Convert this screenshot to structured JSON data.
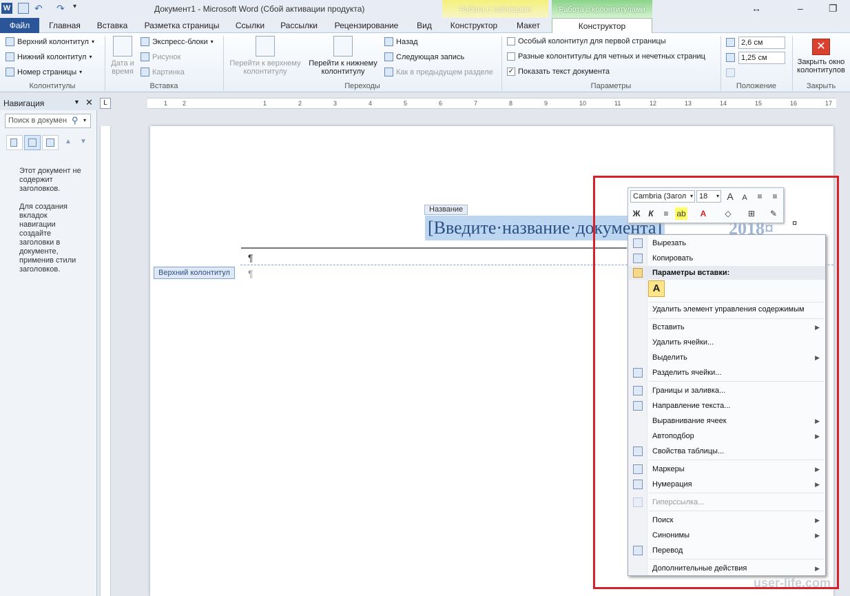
{
  "titlebar": {
    "app_icon": "W",
    "title": "Документ1  -  Microsoft Word (Сбой активации продукта)",
    "group_tables": "Работа с таблицами",
    "group_hf": "Работа с колонтитулами",
    "resize_icon": "↔",
    "minimize": "–",
    "restore": "❐"
  },
  "tabs": {
    "file": "Файл",
    "home": "Главная",
    "insert": "Вставка",
    "layout": "Разметка страницы",
    "refs": "Ссылки",
    "mail": "Рассылки",
    "review": "Рецензирование",
    "view": "Вид",
    "tbl_design": "Конструктор",
    "tbl_layout": "Макет",
    "hf_design": "Конструктор"
  },
  "ribbon": {
    "hf": {
      "header": "Верхний колонтитул",
      "footer": "Нижний колонтитул",
      "pagenum": "Номер страницы",
      "label": "Колонтитулы"
    },
    "insert": {
      "date": "Дата и время",
      "express": "Экспресс-блоки",
      "picture": "Рисунок",
      "clipart": "Картинка",
      "label": "Вставка"
    },
    "nav": {
      "go_header": "Перейти к верхнему колонтитулу",
      "go_footer": "Перейти к нижнему колонтитулу",
      "prev": "Назад",
      "next": "Следующая запись",
      "link_prev": "Как в предыдущем разделе",
      "label": "Переходы"
    },
    "opts": {
      "first": "Особый колонтитул для первой страницы",
      "oddeven": "Разные колонтитулы для четных и нечетных страниц",
      "showdoc": "Показать текст документа",
      "label": "Параметры"
    },
    "pos": {
      "top": "2,6 см",
      "bottom": "1,25 см",
      "label": "Положение"
    },
    "close": {
      "btn": "Закрыть окно колонтитулов",
      "label": "Закрыть"
    }
  },
  "nav": {
    "title": "Навигация",
    "search_placeholder": "Поиск в докумен",
    "text": "Этот документ не содержит заголовков.\n\nДля создания вкладок навигации создайте заголовки в документе, применив стили заголовков."
  },
  "ruler": {
    "marks": [
      "1",
      "2",
      "1",
      "2",
      "3",
      "4",
      "5",
      "6",
      "7",
      "8",
      "9",
      "10",
      "11",
      "12",
      "13",
      "14",
      "15",
      "16",
      "17"
    ],
    "corner": "L"
  },
  "doc": {
    "cc_tag": "Название",
    "cc_title": "[Введите·название·документа]",
    "year": "2018¤",
    "hf_tag": "Верхний колонтитул",
    "pilcrow": "¶",
    "cell_mark": "¤"
  },
  "mini": {
    "font": "Cambria (Загол",
    "size": "18",
    "bold": "Ж",
    "italic": "К"
  },
  "ctx": {
    "cut": "Вырезать",
    "copy": "Копировать",
    "paste_opts": "Параметры вставки:",
    "paste_a": "A",
    "remove_cc": "Удалить элемент управления содержимым",
    "insert": "Вставить",
    "delete_cells": "Удалить ячейки...",
    "select": "Выделить",
    "split": "Разделить ячейки...",
    "borders": "Границы и заливка...",
    "text_dir": "Направление текста...",
    "align": "Выравнивание ячеек",
    "autofit": "Автоподбор",
    "props": "Свойства таблицы...",
    "bullets": "Маркеры",
    "numbering": "Нумерация",
    "hyperlink": "Гиперссылка...",
    "search": "Поиск",
    "synonyms": "Синонимы",
    "translate": "Перевод",
    "more": "Дополнительные действия"
  },
  "watermark": "user-life.com",
  "colors": {
    "file_tab": "#2a5699",
    "highlight_box": "#d6212a",
    "selection": "#bcd6f2"
  }
}
